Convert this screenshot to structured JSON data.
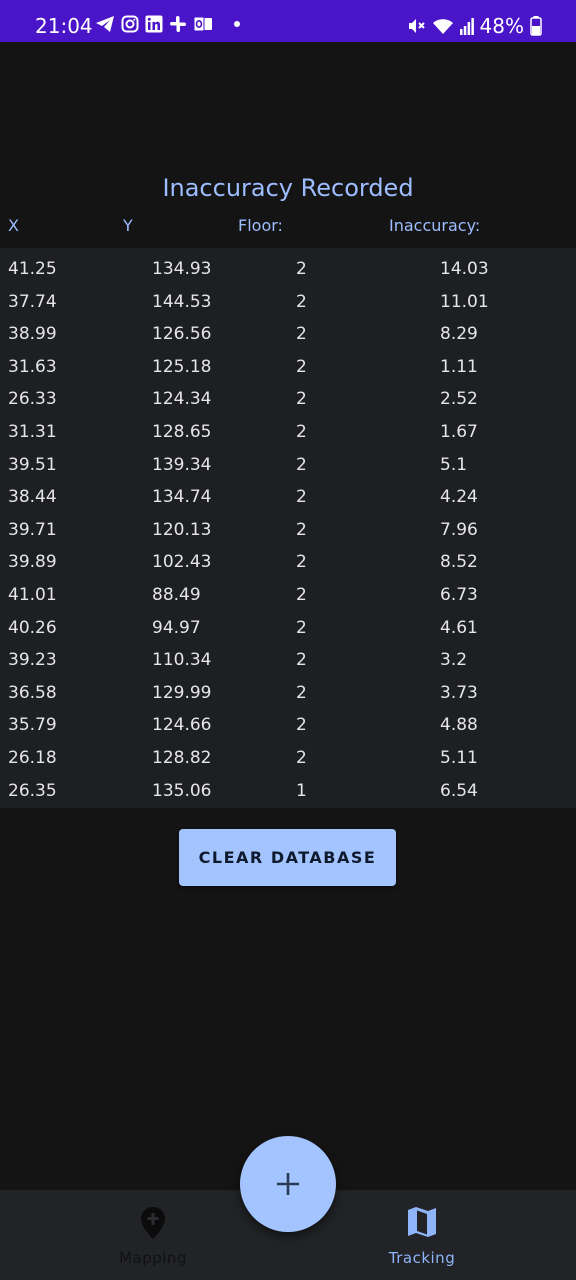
{
  "status_bar": {
    "time": "21:04",
    "battery": "48%",
    "icons": [
      "telegram-icon",
      "instagram-icon",
      "linkedin-icon",
      "slack-icon",
      "outlook-icon",
      "dot-icon",
      "mute-icon",
      "wifi-icon",
      "signal-icon",
      "battery-icon"
    ]
  },
  "screen": {
    "title": "Inaccuracy Recorded",
    "columns": {
      "x": "X",
      "y": "Y",
      "floor": "Floor:",
      "inaccuracy": "Inaccuracy:"
    },
    "rows": [
      {
        "x": "41.25",
        "y": "134.93",
        "floor": "2",
        "inaccuracy": "14.03"
      },
      {
        "x": "37.74",
        "y": "144.53",
        "floor": "2",
        "inaccuracy": "11.01"
      },
      {
        "x": "38.99",
        "y": "126.56",
        "floor": "2",
        "inaccuracy": "8.29"
      },
      {
        "x": "31.63",
        "y": "125.18",
        "floor": "2",
        "inaccuracy": "1.11"
      },
      {
        "x": "26.33",
        "y": "124.34",
        "floor": "2",
        "inaccuracy": "2.52"
      },
      {
        "x": "31.31",
        "y": "128.65",
        "floor": "2",
        "inaccuracy": "1.67"
      },
      {
        "x": "39.51",
        "y": "139.34",
        "floor": "2",
        "inaccuracy": "5.1"
      },
      {
        "x": "38.44",
        "y": "134.74",
        "floor": "2",
        "inaccuracy": "4.24"
      },
      {
        "x": "39.71",
        "y": "120.13",
        "floor": "2",
        "inaccuracy": "7.96"
      },
      {
        "x": "39.89",
        "y": "102.43",
        "floor": "2",
        "inaccuracy": "8.52"
      },
      {
        "x": "41.01",
        "y": "88.49",
        "floor": "2",
        "inaccuracy": "6.73"
      },
      {
        "x": "40.26",
        "y": "94.97",
        "floor": "2",
        "inaccuracy": "4.61"
      },
      {
        "x": "39.23",
        "y": "110.34",
        "floor": "2",
        "inaccuracy": "3.2"
      },
      {
        "x": "36.58",
        "y": "129.99",
        "floor": "2",
        "inaccuracy": "3.73"
      },
      {
        "x": "35.79",
        "y": "124.66",
        "floor": "2",
        "inaccuracy": "4.88"
      },
      {
        "x": "26.18",
        "y": "128.82",
        "floor": "2",
        "inaccuracy": "5.11"
      },
      {
        "x": "26.35",
        "y": "135.06",
        "floor": "1",
        "inaccuracy": "6.54"
      }
    ],
    "clear_button": "CLEAR DATABASE"
  },
  "fab": {
    "icon": "plus-icon"
  },
  "bottom_nav": {
    "items": [
      {
        "label": "Mapping",
        "icon": "location-pin-icon",
        "active": false
      },
      {
        "label": "Tracking",
        "icon": "map-icon",
        "active": true
      }
    ]
  },
  "colors": {
    "status_bar": "#4a14c8",
    "background": "#141414",
    "table_background": "#1d1f22",
    "accent": "#a4c4ff",
    "header_text": "#9dbdff"
  }
}
